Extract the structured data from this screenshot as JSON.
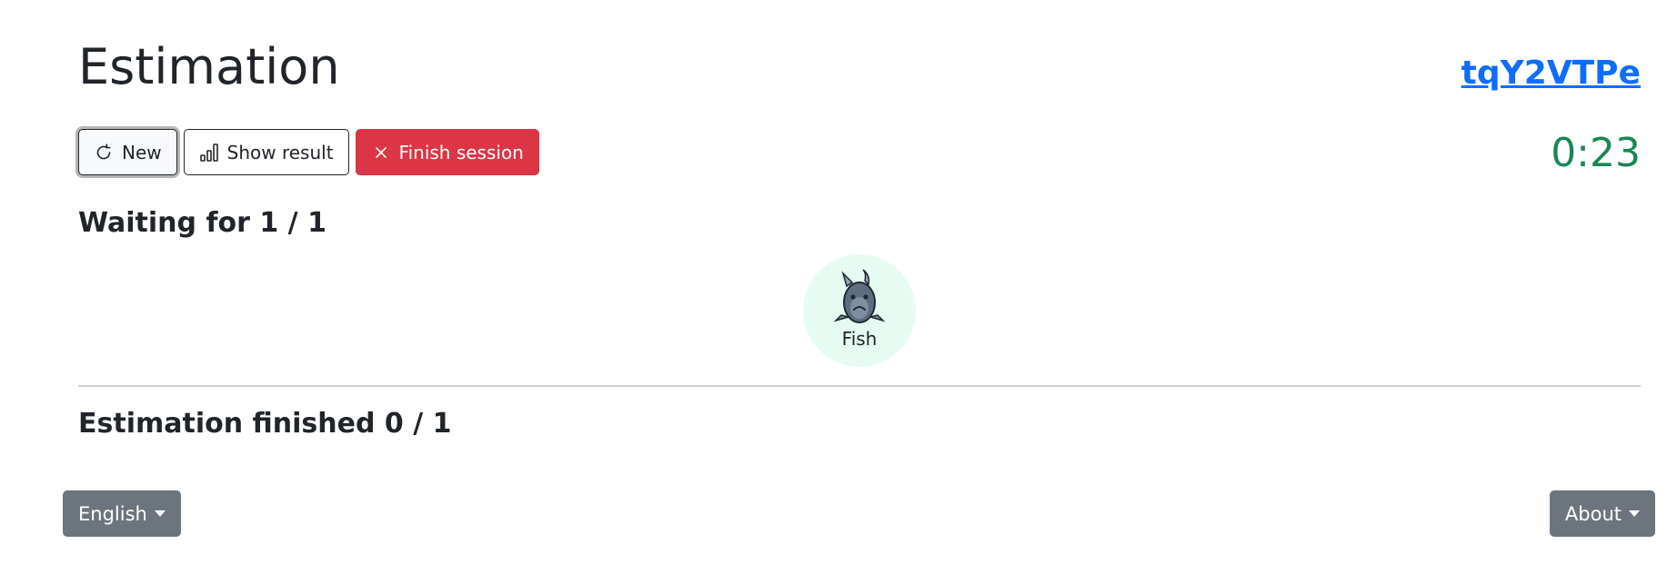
{
  "header": {
    "title": "Estimation",
    "session_code": "tqY2VTPe"
  },
  "toolbar": {
    "new_label": "New",
    "show_result_label": "Show result",
    "finish_session_label": "Finish session",
    "icons": {
      "new": "refresh-icon",
      "show_result": "bar-chart-icon",
      "finish_session": "close-icon"
    }
  },
  "timer": {
    "value": "0:23",
    "color": "#198754"
  },
  "waiting": {
    "heading": "Waiting for 1 / 1",
    "participants": [
      {
        "name": "Fish",
        "avatar": "fish-avatar-icon",
        "background": "#e6fcf2"
      }
    ]
  },
  "finished": {
    "heading": "Estimation finished 0 / 1"
  },
  "footer": {
    "language_label": "English",
    "about_label": "About"
  },
  "colors": {
    "link": "#0d6efd",
    "danger": "#dc3545",
    "secondary": "#6c757d",
    "text": "#212529"
  }
}
